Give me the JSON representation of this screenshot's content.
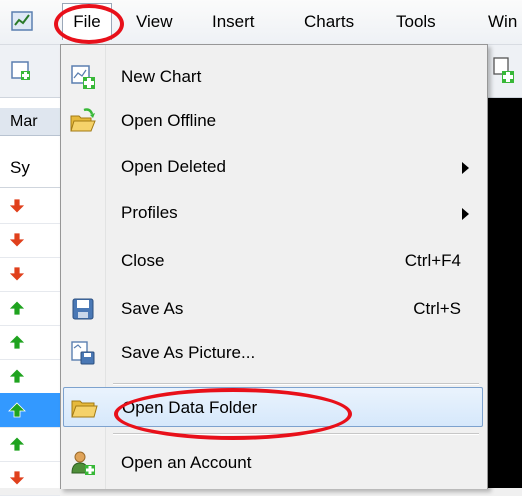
{
  "menubar": {
    "items": [
      "File",
      "View",
      "Insert",
      "Charts",
      "Tools",
      "Win"
    ]
  },
  "left_panel": {
    "title": "Mar",
    "column": "Sy",
    "rows": [
      {
        "direction": "down"
      },
      {
        "direction": "down"
      },
      {
        "direction": "down"
      },
      {
        "direction": "up"
      },
      {
        "direction": "up"
      },
      {
        "direction": "up"
      },
      {
        "direction": "up",
        "selected": true
      },
      {
        "direction": "up"
      },
      {
        "direction": "down"
      }
    ]
  },
  "panel_close": "×",
  "file_menu": {
    "items": [
      {
        "label": "New Chart",
        "icon": "new-chart-icon"
      },
      {
        "label": "Open Offline",
        "icon": "open-folder-icon"
      },
      {
        "label": "Open Deleted",
        "submenu": true
      },
      {
        "label": "Profiles",
        "submenu": true
      },
      {
        "label": "Close",
        "shortcut": "Ctrl+F4"
      },
      {
        "label": "Save As",
        "shortcut": "Ctrl+S",
        "icon": "save-icon"
      },
      {
        "label": "Save As Picture...",
        "icon": "save-picture-icon"
      },
      {
        "label": "Open Data Folder",
        "icon": "data-folder-icon",
        "highlighted": true
      },
      {
        "label": "Open an Account",
        "icon": "account-icon"
      }
    ]
  },
  "colors": {
    "annotation": "#e8101a",
    "arrow_up": "#1fa31f",
    "arrow_down": "#e0401c",
    "selection": "#3399ff",
    "highlight_border": "#7da2ce"
  }
}
